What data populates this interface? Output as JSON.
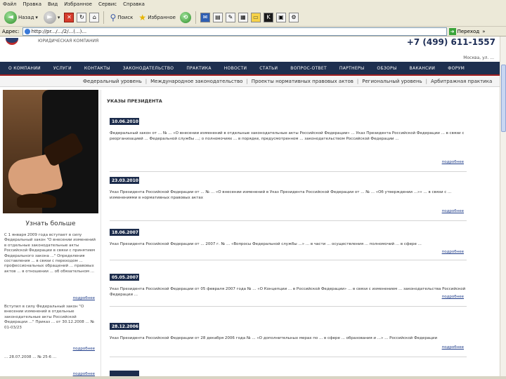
{
  "browser": {
    "menu": [
      "Файл",
      "Правка",
      "Вид",
      "Избранное",
      "Сервис",
      "Справка"
    ],
    "toolbar": {
      "back_label": "Назад",
      "search_label": "Поиск",
      "favorites_label": "Избранное"
    },
    "address_label": "Адрес:",
    "address_value": "http://pr.../.../2/...(...)...",
    "go_label": "Переход",
    "links_label": "»"
  },
  "site": {
    "name": "ЮРИДИЧЕСКАЯ КОМПАНИЯ",
    "phone": "+7 (499) 611-1557",
    "address": "Москва, ул. ...",
    "topnav": [
      "О КОМПАНИИ",
      "УСЛУГИ",
      "КОНТАКТЫ",
      "ЗАКОНОДАТЕЛЬСТВО",
      "ПРАКТИКА",
      "НОВОСТИ",
      "СТАТЬИ",
      "ВОПРОС-ОТВЕТ",
      "ПАРТНЕРЫ",
      "ОБЗОРЫ",
      "ВАКАНСИИ",
      "ФОРУМ"
    ],
    "subnav": [
      "Федеральный уровень",
      "Международное законодательство",
      "Проекты нормативных правовых актов",
      "Региональный уровень",
      "Арбитражная практика"
    ]
  },
  "left": {
    "learn_more": "Узнать больше",
    "news": [
      {
        "text": "С 1 января 2009 года вступает в силу Федеральный закон \"О внесении изменений в отдельные законодательные акты Российской Федерации в связи с принятием Федерального закона ...\" Определения составления ... в связи с переходом ... профессиональных обращений ... правовых актов ... в отношении ... об обязательном ...",
        "more": "подробнее"
      },
      {
        "text": "Вступил в силу Федеральный закон \"О внесении изменений в отдельные законодательные акты Российской Федерации ...\" Приказ ... от 30.12.2008 ... № 01-03/23",
        "more": "подробнее"
      },
      {
        "text": "... 28.07.2008 ... № 25-6 ...",
        "more": "подробнее"
      }
    ]
  },
  "main": {
    "section_title": "УКАЗЫ ПРЕЗИДЕНТА",
    "entries": [
      {
        "date": "10.06.2010",
        "text": "Федеральный закон от ... № ... «О внесении изменений в отдельные законодательные акты Российской Федерации» ... Указ Президента Российской Федерации ... в связи с реорганизацией ... Федеральной службы ...; о полномочиях ... в порядке, предусмотренном ... законодательством Российской Федерации ...",
        "more": "подробнее"
      },
      {
        "date": "23.03.2010",
        "text": "Указ Президента Российской Федерации от ... № ... «О внесении изменений в Указ Президента Российской Федерации от ... № ... «Об утверждении ...»» ... в связи с ... изменениями в нормативных правовых актах",
        "more": "подробнее"
      },
      {
        "date": "18.06.2007",
        "text": "Указ Президента Российской Федерации от ... 2007 г. № ... «Вопросы Федеральной службы ...» ... в части ... осуществления ... полномочий ... в сфере ...",
        "more": "подробнее"
      },
      {
        "date": "05.05.2007",
        "text": "Указ Президента Российской Федерации от 05 февраля 2007 года № ... «О Концепции ... в Российской Федерации» ... в связи с изменением ... законодательства Российской Федерации ...",
        "more": "подробнее"
      },
      {
        "date": "28.12.2006",
        "text": "Указ Президента Российской Федерации от 28 декабря 2006 года № ... «О дополнительных мерах по ... в сфере ... образования и ...» ... Российской Федерации",
        "more": "подробнее"
      },
      {
        "date": "",
        "text": "",
        "more": ""
      }
    ]
  }
}
